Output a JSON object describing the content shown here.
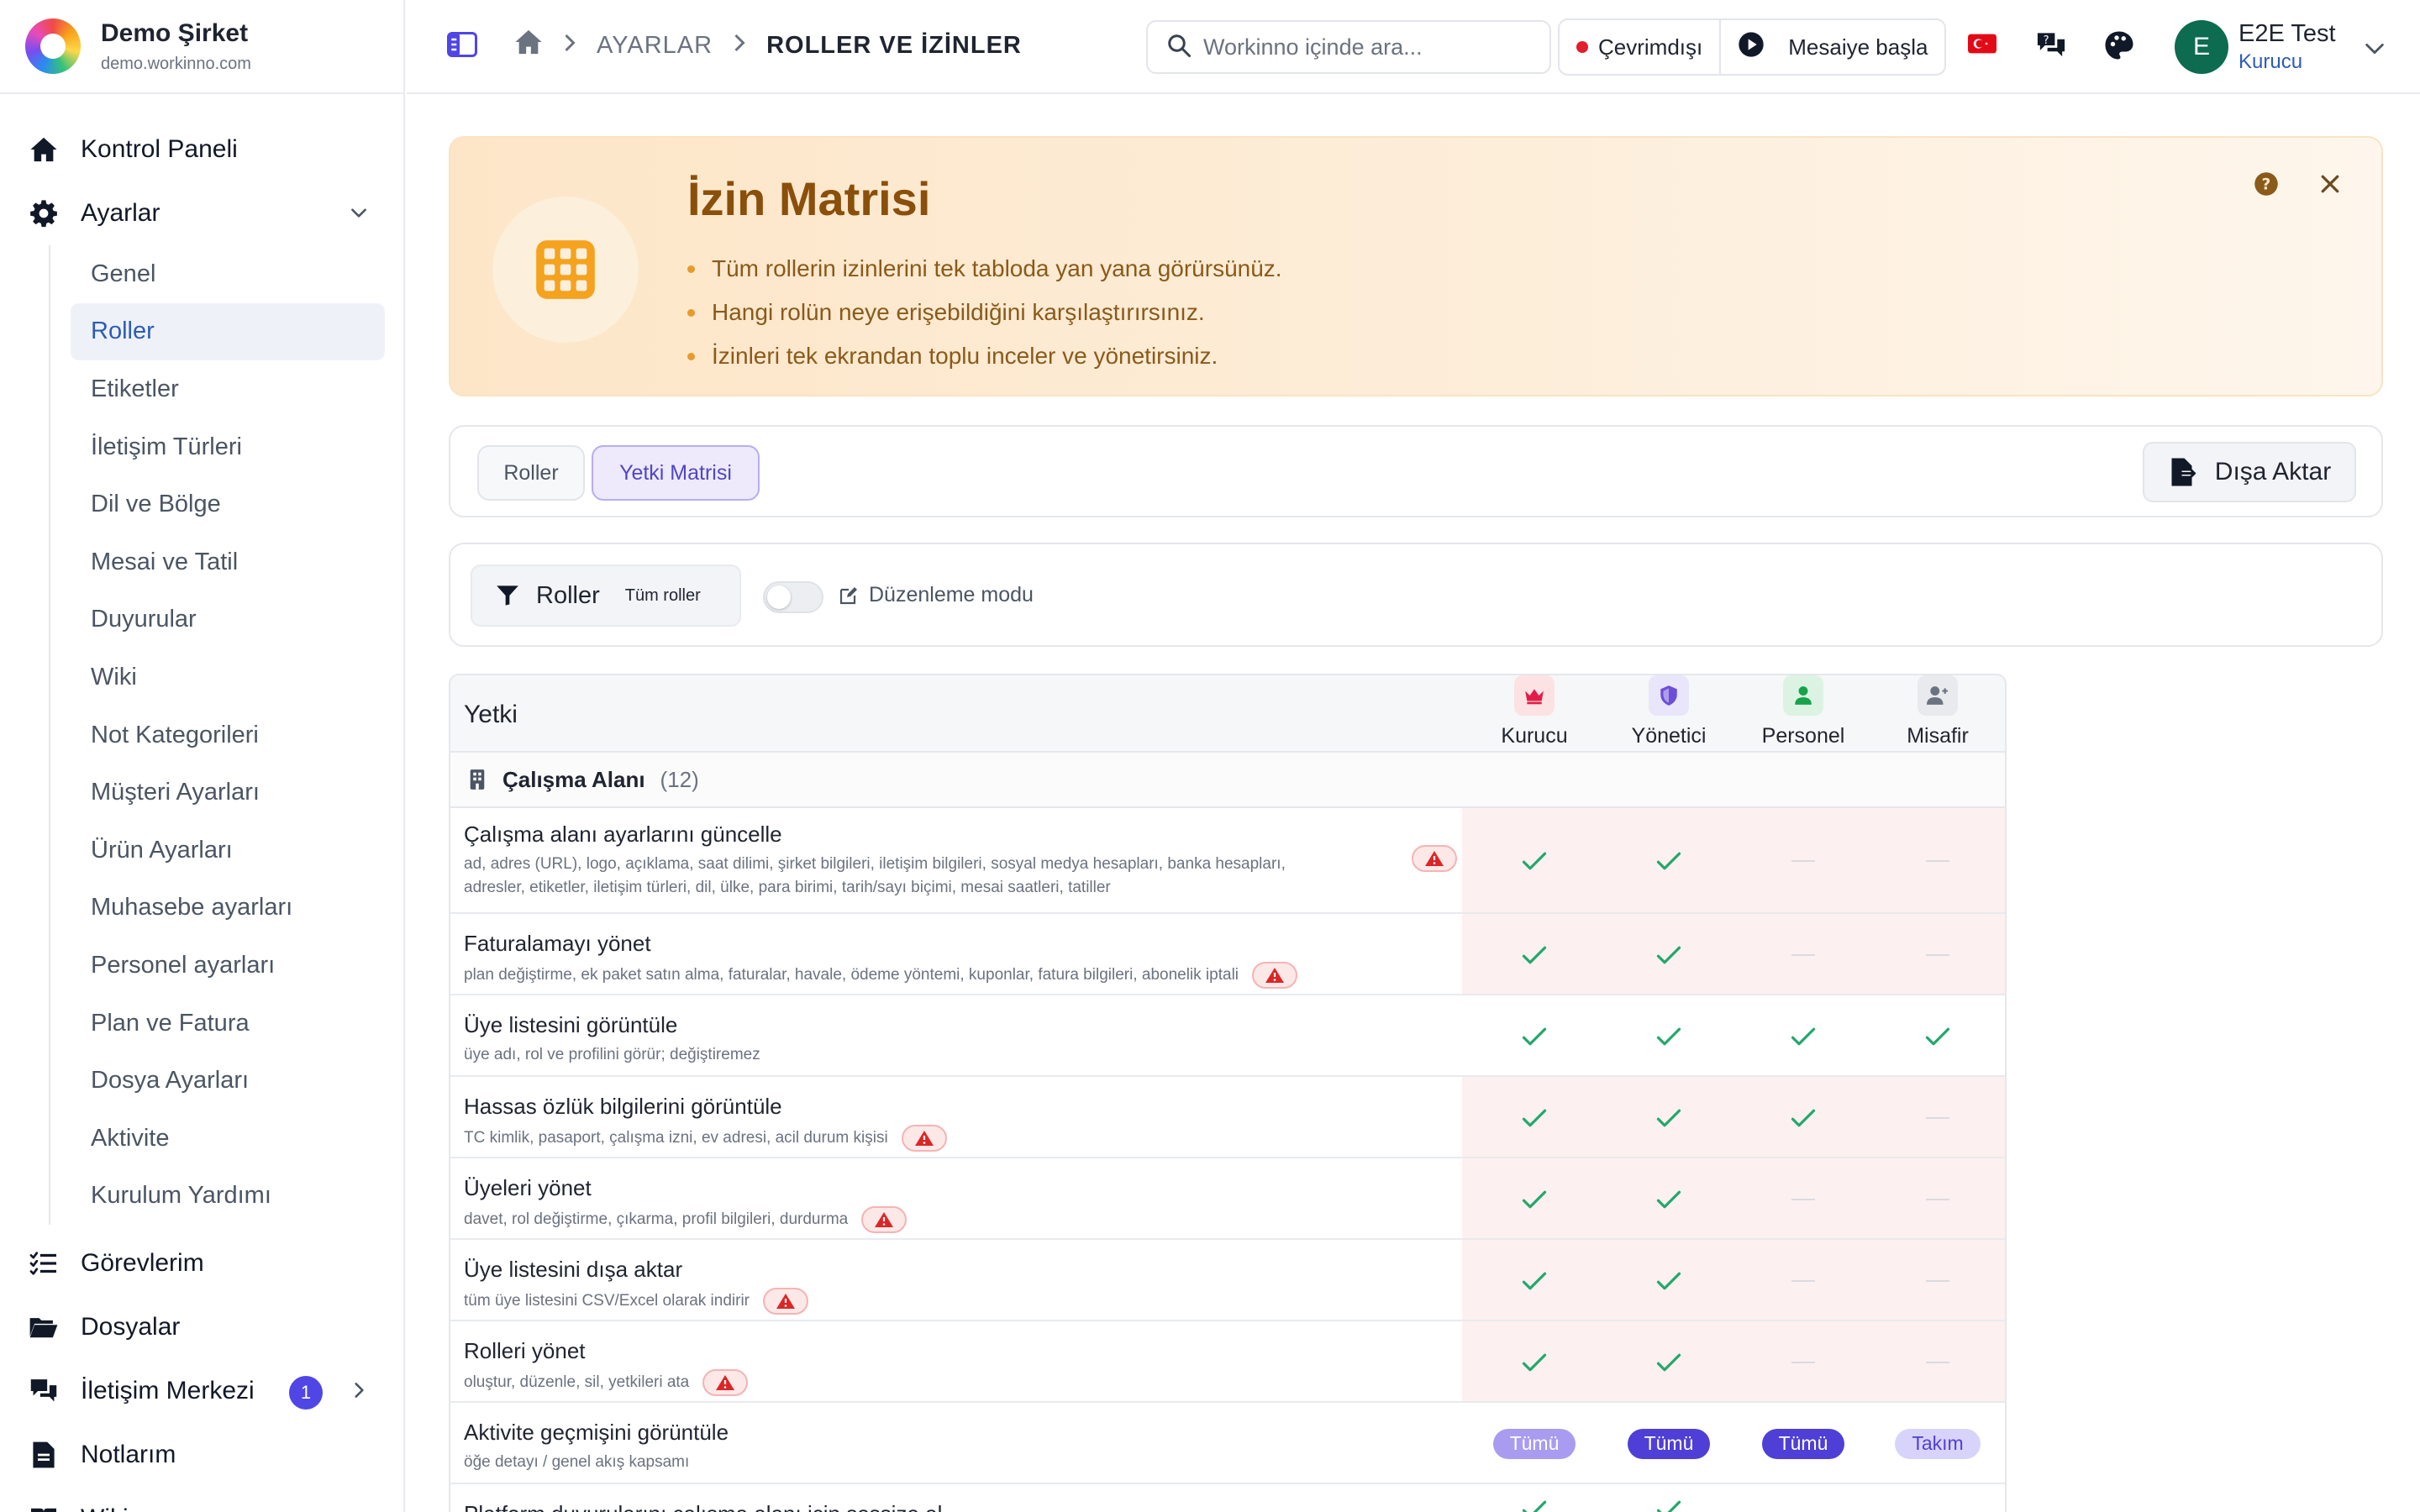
{
  "brand": {
    "name": "Demo Şirket",
    "domain": "demo.workinno.com"
  },
  "nav": {
    "dashboard": "Kontrol Paneli",
    "settings": "Ayarlar",
    "sub": [
      "Genel",
      "Roller",
      "Etiketler",
      "İletişim Türleri",
      "Dil ve Bölge",
      "Mesai ve Tatil",
      "Duyurular",
      "Wiki",
      "Not Kategorileri",
      "Müşteri Ayarları",
      "Ürün Ayarları",
      "Muhasebe ayarları",
      "Personel ayarları",
      "Plan ve Fatura",
      "Dosya Ayarları",
      "Aktivite",
      "Kurulum Yardımı"
    ],
    "active_sub": "Roller",
    "tasks": "Görevlerim",
    "files": "Dosyalar",
    "comm": "İletişim Merkezi",
    "comm_badge": "1",
    "notes": "Notlarım",
    "wiki": "Wiki"
  },
  "topbar": {
    "crumb1": "AYARLAR",
    "crumb2": "ROLLER VE İZİNLER",
    "search_placeholder": "Workinno içinde ara...",
    "status": "Çevrimdışı",
    "start_shift": "Mesaiye başla",
    "user_initial": "E",
    "user_name": "E2E Test",
    "user_role": "Kurucu"
  },
  "hero": {
    "title": "İzin Matrisi",
    "bullets": [
      "Tüm rollerin izinlerini tek tabloda yan yana görürsünüz.",
      "Hangi rolün neye erişebildiğini karşılaştırırsınız.",
      "İzinleri tek ekrandan toplu inceler ve yönetirsiniz."
    ]
  },
  "tabs": {
    "roles": "Roller",
    "matrix": "Yetki Matrisi",
    "export": "Dışa Aktar"
  },
  "filter": {
    "roles_label": "Roller",
    "roles_value": "Tüm roller",
    "edit_mode": "Düzenleme modu",
    "edit_mode_on": false
  },
  "matrix": {
    "header": "Yetki",
    "roles": [
      {
        "name": "Kurucu",
        "icon": "crown-icon",
        "color": "#e11d48",
        "bg": "#fde2e4"
      },
      {
        "name": "Yönetici",
        "icon": "shield-icon",
        "color": "#6d4ed8",
        "bg": "#e9e5fb"
      },
      {
        "name": "Personel",
        "icon": "user-icon",
        "color": "#16a34a",
        "bg": "#dcf3e4"
      },
      {
        "name": "Misafir",
        "icon": "user-plus-icon",
        "color": "#6b7280",
        "bg": "#e8eaee"
      }
    ],
    "group": {
      "name": "Çalışma Alanı",
      "count": "(12)"
    },
    "rows": [
      {
        "title": "Çalışma alanı ayarlarını güncelle",
        "desc": [
          "ad, adres (URL), logo, açıklama, saat dilimi, şirket bilgileri, iletişim bilgileri, sosyal medya hesapları, banka hesapları,",
          "adresler, etiketler, iletişim türleri, dil, ülke, para birimi, tarih/sayı biçimi, mesai saatleri, tatiller"
        ],
        "risk": true,
        "values": [
          "check",
          "check",
          "dash",
          "dash"
        ]
      },
      {
        "title": "Faturalamayı yönet",
        "desc": [
          "plan değiştirme, ek paket satın alma, faturalar, havale, ödeme yöntemi, kuponlar, fatura bilgileri, abonelik iptali"
        ],
        "risk": true,
        "values": [
          "check",
          "check",
          "dash",
          "dash"
        ]
      },
      {
        "title": "Üye listesini görüntüle",
        "desc": [
          "üye adı, rol ve profilini görür; değiştiremez"
        ],
        "risk": false,
        "values": [
          "check",
          "check",
          "check",
          "check"
        ]
      },
      {
        "title": "Hassas özlük bilgilerini görüntüle",
        "desc": [
          "TC kimlik, pasaport, çalışma izni, ev adresi, acil durum kişisi"
        ],
        "risk": true,
        "values": [
          "check",
          "check",
          "check",
          "dash"
        ]
      },
      {
        "title": "Üyeleri yönet",
        "desc": [
          "davet, rol değiştirme, çıkarma, profil bilgileri, durdurma"
        ],
        "risk": true,
        "values": [
          "check",
          "check",
          "dash",
          "dash"
        ]
      },
      {
        "title": "Üye listesini dışa aktar",
        "desc": [
          "tüm üye listesini CSV/Excel olarak indirir"
        ],
        "risk": true,
        "values": [
          "check",
          "check",
          "dash",
          "dash"
        ]
      },
      {
        "title": "Rolleri yönet",
        "desc": [
          "oluştur, düzenle, sil, yetkileri ata"
        ],
        "risk": true,
        "values": [
          "check",
          "check",
          "dash",
          "dash"
        ]
      },
      {
        "title": "Aktivite geçmişini görüntüle",
        "desc": [
          "öğe detayı / genel akış kapsamı"
        ],
        "risk": false,
        "values": [
          "Tümü",
          "Tümü",
          "Tümü",
          "Takım"
        ]
      },
      {
        "title": "Platform duyurularını çalışma alanı için sessize al",
        "desc": [],
        "risk": false,
        "values": [
          "check",
          "check",
          "",
          ""
        ]
      }
    ]
  },
  "colors": {
    "accent": "#4f46e5",
    "check": "#22a86b",
    "risk_bg": "#fdf0f0",
    "hero_title": "#8a4f0a"
  }
}
